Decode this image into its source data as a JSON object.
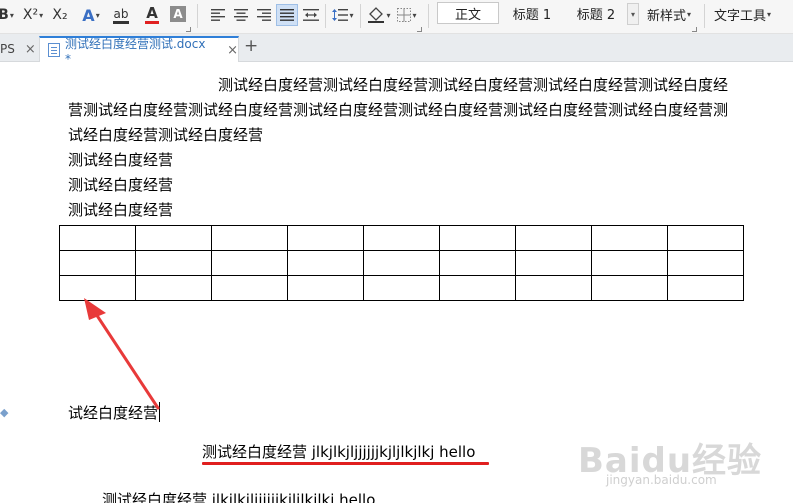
{
  "toolbar": {
    "bold_label": "B",
    "superscript_label": "X²",
    "subscript_label": "X₂",
    "text_effect_label": "A",
    "highlight_label": "ab",
    "font_color_label": "A",
    "char_shading_label": "A",
    "font_color_accent": "#e02020",
    "highlight_accent": "#333333",
    "style_gallery": [
      {
        "label": "正文",
        "selected": true
      },
      {
        "label": "标题 1",
        "selected": false
      },
      {
        "label": "标题 2",
        "selected": false
      }
    ],
    "new_style_label": "新样式",
    "text_tools_label": "文字工具"
  },
  "tabs": {
    "wps_tab_label": "PS",
    "active_tab_label": "测试经白度经营测试.docx *",
    "close_label": "×",
    "new_tab_label": "+"
  },
  "document": {
    "paragraph_1": "测试经白度经营测试经白度经营测试经白度经营测试经白度经营测试经白度经营测试经白度经营测试经白度经营测试经白度经营测试经白度经营测试经白度经营测试经白度经营测试经白度经营测试经白度经营",
    "lines": [
      "测试经白度经营",
      "测试经白度经营",
      "测试经白度经营"
    ],
    "table": {
      "rows": 3,
      "cols": 9
    },
    "cursor_line": "试经白度经营",
    "underlined_line": "测试经白度经营 jlkjlkjljjjjjjkjljlkjlkj    hello",
    "bottom_line": "测试经白度经营 jlkjlkjljjjjjjkjljlkjlkj    hello"
  },
  "annotation": {
    "arrow_color": "#e83a3a",
    "underline_color": "#e01f1f"
  },
  "watermark": {
    "brand": "Baidu经验",
    "url": "jingyan.baidu.com"
  }
}
